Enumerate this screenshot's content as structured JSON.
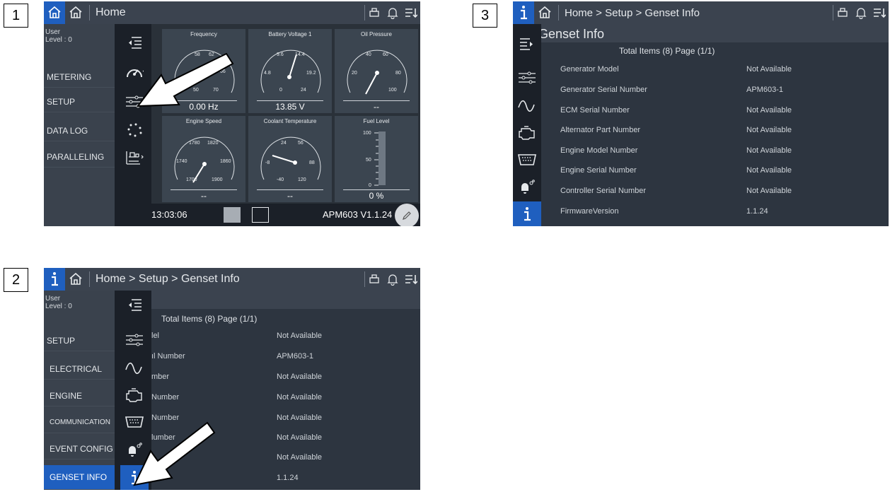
{
  "steps": [
    "1",
    "2",
    "3"
  ],
  "header": {
    "home_title": "Home",
    "genset_path": "Home > Setup > Genset Info"
  },
  "user": {
    "line1": "User",
    "line2": "Level : 0"
  },
  "panel1": {
    "menu": [
      "METERING",
      "SETUP",
      "DATA LOG",
      "PARALLELING"
    ],
    "gauges": [
      {
        "title": "Frequency",
        "value": "0.00 Hz",
        "ticks": [
          "58",
          "62",
          "66",
          "70",
          "50"
        ]
      },
      {
        "title": "Battery Voltage 1",
        "value": "13.85 V",
        "ticks": [
          "9.6",
          "14.4",
          "4.8",
          "19.2",
          "0",
          "24"
        ]
      },
      {
        "title": "Oil Pressure",
        "value": "--",
        "ticks": [
          "40",
          "60",
          "20",
          "80",
          "100"
        ]
      },
      {
        "title": "Engine Speed",
        "value": "--",
        "ticks": [
          "1780",
          "1820",
          "1740",
          "1860",
          "1700",
          "1900"
        ]
      },
      {
        "title": "Coolant Temperature",
        "value": "--",
        "ticks": [
          "24",
          "56",
          "-8",
          "88",
          "-40",
          "120"
        ]
      },
      {
        "title": "Fuel Level",
        "value": "0 %",
        "ticks": [
          "100",
          "50",
          "0"
        ]
      }
    ],
    "time": "13:03:06",
    "version": "APM603 V1.1.24"
  },
  "panel2": {
    "menu": [
      "SETUP",
      "ELECTRICAL",
      "ENGINE",
      "COMMUNICATION",
      "EVENT CONFIG",
      "GENSET INFO"
    ],
    "total_items": "Total Items (8) Page (1/1)",
    "rows": [
      {
        "label": "lel",
        "value": "Not Available"
      },
      {
        "label": "ıl Number",
        "value": "APM603-1"
      },
      {
        "label": "mber",
        "value": "Not Available"
      },
      {
        "label": "Number",
        "value": "Not Available"
      },
      {
        "label": "Number",
        "value": "Not Available"
      },
      {
        "label": "lumber",
        "value": "Not Available"
      },
      {
        "label": "",
        "value": "Not Available"
      },
      {
        "label": "on",
        "value": "1.1.24"
      }
    ]
  },
  "panel3": {
    "page_title": "Genset Info",
    "total_items": "Total Items (8) Page (1/1)",
    "rows": [
      {
        "label": "Generator Model",
        "value": "Not Available"
      },
      {
        "label": "Generator Serial Number",
        "value": "APM603-1"
      },
      {
        "label": "ECM Serial Number",
        "value": "Not Available"
      },
      {
        "label": "Alternator Part Number",
        "value": "Not Available"
      },
      {
        "label": "Engine Model Number",
        "value": "Not Available"
      },
      {
        "label": "Engine Serial Number",
        "value": "Not Available"
      },
      {
        "label": "Controller Serial Number",
        "value": "Not Available"
      },
      {
        "label": "FirmwareVersion",
        "value": "1.1.24"
      }
    ]
  },
  "colors": {
    "accent": "#1f5fbf",
    "panel_bg": "#2d3540",
    "topbar": "#3b434f",
    "icon_col": "#1b2028"
  }
}
